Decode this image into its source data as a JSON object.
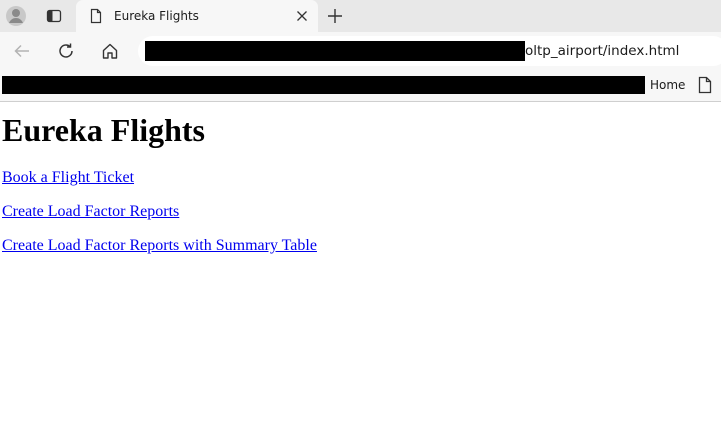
{
  "browser": {
    "tab": {
      "title": "Eureka Flights"
    },
    "address_bar": {
      "url_visible": "oltp_airport/index.html"
    },
    "bookmarks_bar": {
      "home_label": "Home"
    }
  },
  "page": {
    "title": "Eureka Flights",
    "links": [
      {
        "label": "Book a Flight Ticket"
      },
      {
        "label": "Create Load Factor Reports"
      },
      {
        "label": "Create Load Factor Reports with Summary Table"
      }
    ]
  },
  "colors": {
    "link": "#0000ee",
    "tabstrip_bg": "#e8e8e8",
    "toolbar_bg": "#f7f7f7"
  }
}
